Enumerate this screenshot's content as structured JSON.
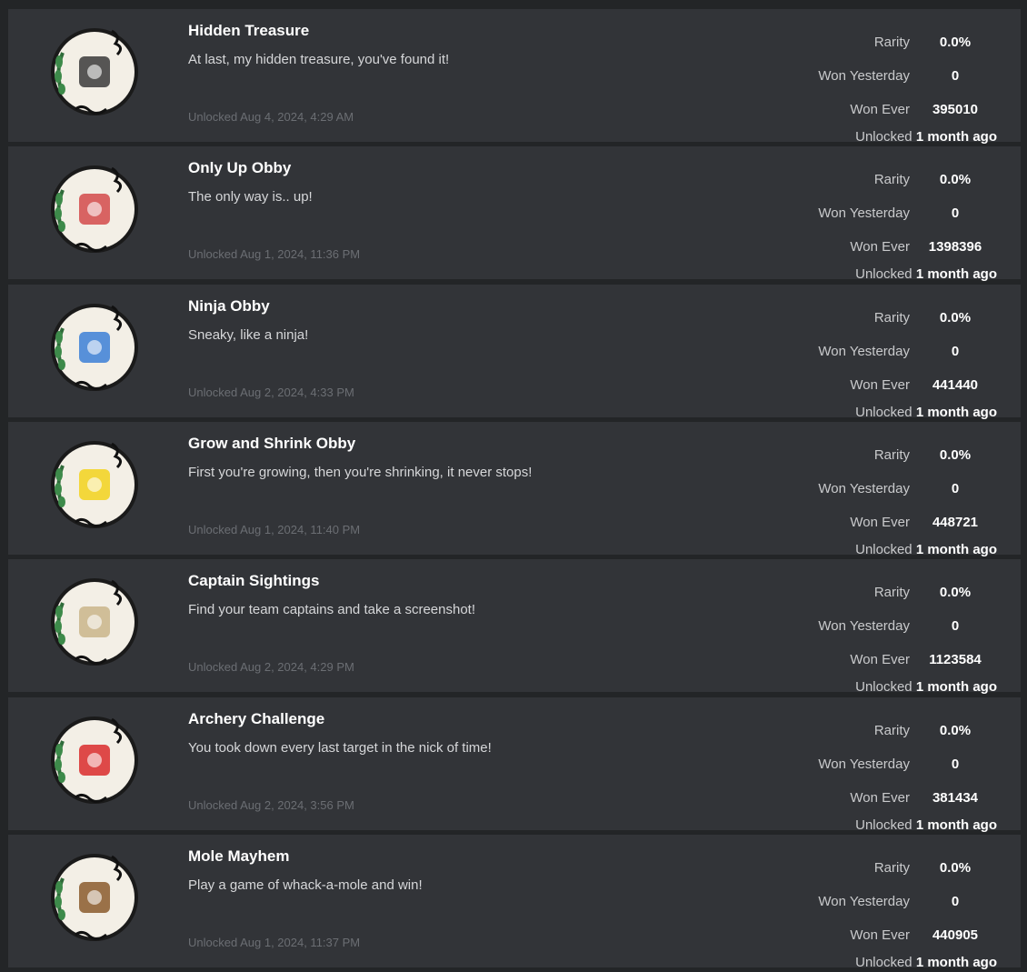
{
  "colors": {
    "page_bg": "#232527",
    "card_bg": "#323438",
    "title": "#ffffff",
    "muted": "#6b6e73"
  },
  "labels": {
    "rarity": "Rarity",
    "won_yesterday": "Won Yesterday",
    "won_ever": "Won Ever",
    "unlocked": "Unlocked"
  },
  "badges": [
    {
      "name": "Hidden Treasure",
      "description": "At last, my hidden treasure, you've found it!",
      "unlocked_date": "Unlocked Aug 4, 2024, 4:29 AM",
      "rarity": "0.0%",
      "won_yesterday": "0",
      "won_ever": "395010",
      "unlocked_ago": "1 month ago",
      "icon": "treasure-chest-icon",
      "accent": "#3a3a3a"
    },
    {
      "name": "Only Up Obby",
      "description": "The only way is.. up!",
      "unlocked_date": "Unlocked Aug 1, 2024, 11:36 PM",
      "rarity": "0.0%",
      "won_yesterday": "0",
      "won_ever": "1398396",
      "unlocked_ago": "1 month ago",
      "icon": "climbing-figure-icon",
      "accent": "#d24a4a"
    },
    {
      "name": "Ninja Obby",
      "description": "Sneaky, like a ninja!",
      "unlocked_date": "Unlocked Aug 2, 2024, 4:33 PM",
      "rarity": "0.0%",
      "won_yesterday": "0",
      "won_ever": "441440",
      "unlocked_ago": "1 month ago",
      "icon": "ninja-arrows-icon",
      "accent": "#3b7fd6"
    },
    {
      "name": "Grow and Shrink Obby",
      "description": "First you're growing, then you're shrinking, it never stops!",
      "unlocked_date": "Unlocked Aug 1, 2024, 11:40 PM",
      "rarity": "0.0%",
      "won_yesterday": "0",
      "won_ever": "448721",
      "unlocked_ago": "1 month ago",
      "icon": "noob-character-icon",
      "accent": "#f2d21c"
    },
    {
      "name": "Captain Sightings",
      "description": "Find your team captains and take a screenshot!",
      "unlocked_date": "Unlocked Aug 2, 2024, 4:29 PM",
      "rarity": "0.0%",
      "won_yesterday": "0",
      "won_ever": "1123584",
      "unlocked_ago": "1 month ago",
      "icon": "photo-frame-icon",
      "accent": "#c9b58a"
    },
    {
      "name": "Archery Challenge",
      "description": "You took down every last target in the nick of time!",
      "unlocked_date": "Unlocked Aug 2, 2024, 3:56 PM",
      "rarity": "0.0%",
      "won_yesterday": "0",
      "won_ever": "381434",
      "unlocked_ago": "1 month ago",
      "icon": "archery-target-icon",
      "accent": "#d92b2b"
    },
    {
      "name": "Mole Mayhem",
      "description": "Play a game of whack-a-mole and win!",
      "unlocked_date": "Unlocked Aug 1, 2024, 11:37 PM",
      "rarity": "0.0%",
      "won_yesterday": "0",
      "won_ever": "440905",
      "unlocked_ago": "1 month ago",
      "icon": "mole-icon",
      "accent": "#8a5a2b"
    }
  ]
}
